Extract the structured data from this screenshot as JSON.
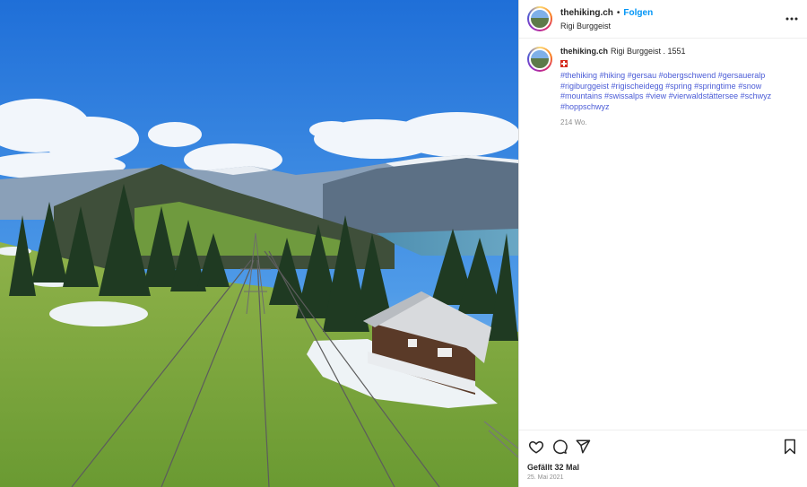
{
  "post": {
    "username": "thehiking.ch",
    "follow_label": "Folgen",
    "location": "Rigi Burggeist",
    "more_icon": "more-horizontal-icon",
    "image_description_icon": "landscape-photo"
  },
  "caption": {
    "username": "thehiking.ch",
    "text": "Rigi Burggeist . 1551",
    "flag": "swiss-flag-icon",
    "hashtags": [
      "#thehiking",
      "#hiking",
      "#gersau",
      "#obergschwend",
      "#gersaueralp",
      "#rigiburggeist",
      "#rigischeidegg",
      "#spring",
      "#springtime",
      "#snow",
      "#mountains",
      "#swissalps",
      "#view",
      "#vierwaldstättersee",
      "#schwyz",
      "#hoppschwyz"
    ],
    "age": "214 Wo."
  },
  "footer": {
    "likes": "Gefällt 32 Mal",
    "date": "25. Mai 2021",
    "icons": [
      "heart-icon",
      "comment-icon",
      "share-icon",
      "bookmark-icon"
    ]
  },
  "colors": {
    "link": "#0095f6",
    "hashtag": "#4a5bd6",
    "muted": "#8e8e8e"
  }
}
